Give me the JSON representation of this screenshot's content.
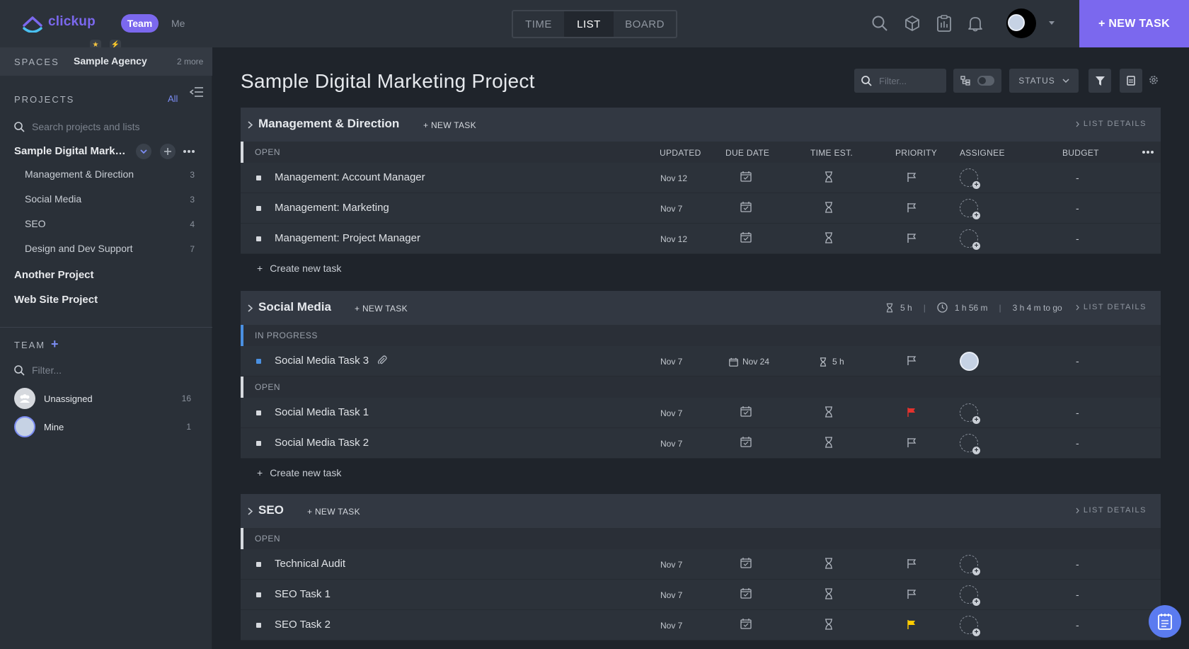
{
  "brand": {
    "name": "clickup",
    "color": "#7b68ee"
  },
  "topbar": {
    "tab_team": "Team",
    "tab_me": "Me",
    "views": [
      "TIME",
      "LIST",
      "BOARD"
    ],
    "active_view": "LIST",
    "new_task_label": "+ NEW TASK",
    "icons": [
      "search-icon",
      "cube-icon",
      "clipboard-icon",
      "bell-icon"
    ]
  },
  "sidebar": {
    "spaces_label": "SPACES",
    "space_name": "Sample Agency",
    "space_more": "2 more",
    "projects_label": "PROJECTS",
    "projects_all": "All",
    "search_placeholder": "Search projects and lists",
    "current_project": "Sample Digital Marke...",
    "lists": [
      {
        "label": "Management & Direction",
        "count": "3"
      },
      {
        "label": "Social Media",
        "count": "3"
      },
      {
        "label": "SEO",
        "count": "4"
      },
      {
        "label": "Design and Dev Support",
        "count": "7"
      }
    ],
    "other_projects": [
      "Another Project",
      "Web Site Project"
    ],
    "team_label": "TEAM",
    "team_plus": "+",
    "team_filter_placeholder": "Filter...",
    "members": [
      {
        "name": "Unassigned",
        "count": "16"
      },
      {
        "name": "Mine",
        "count": "1"
      }
    ]
  },
  "main": {
    "title": "Sample Digital Marketing Project",
    "filter_placeholder": "Filter...",
    "status_label": "STATUS",
    "columns": {
      "updated": "UPDATED",
      "due": "DUE DATE",
      "estimate": "TIME EST.",
      "priority": "PRIORITY",
      "assignee": "ASSIGNEE",
      "budget": "BUDGET"
    },
    "list_details": "LIST DETAILS",
    "new_task": "+ NEW TASK",
    "create_task": "Create new task",
    "sections": [
      {
        "title": "Management & Direction",
        "groups": [
          {
            "status": "OPEN",
            "tasks": [
              {
                "name": "Management: Account Manager",
                "updated": "Nov 12",
                "budget": "-"
              },
              {
                "name": "Management: Marketing",
                "updated": "Nov 7",
                "budget": "-"
              },
              {
                "name": "Management: Project Manager",
                "updated": "Nov 12",
                "budget": "-"
              }
            ]
          }
        ]
      },
      {
        "title": "Social Media",
        "stats": {
          "estimate": "5 h",
          "tracked": "1 h 56 m",
          "remaining": "3 h 4 m to go"
        },
        "groups": [
          {
            "status": "IN PROGRESS",
            "tasks": [
              {
                "name": "Social Media Task 3",
                "updated": "Nov 7",
                "due": "Nov 24",
                "estimate": "5 h",
                "budget": "-"
              }
            ]
          },
          {
            "status": "OPEN",
            "tasks": [
              {
                "name": "Social Media Task 1",
                "updated": "Nov 7",
                "budget": "-",
                "priority": "urgent"
              },
              {
                "name": "Social Media Task 2",
                "updated": "Nov 7",
                "budget": "-"
              }
            ]
          }
        ]
      },
      {
        "title": "SEO",
        "groups": [
          {
            "status": "OPEN",
            "tasks": [
              {
                "name": "Technical Audit",
                "updated": "Nov 7",
                "budget": "-"
              },
              {
                "name": "SEO Task 1",
                "updated": "Nov 7",
                "budget": "-"
              },
              {
                "name": "SEO Task 2",
                "updated": "Nov 7",
                "budget": "-",
                "priority": "high"
              }
            ]
          }
        ]
      }
    ]
  },
  "colors": {
    "accent": "#7b68ee",
    "in_progress": "#4a90e2",
    "urgent_flag": "#e5322d",
    "high_flag": "#ffcc00"
  }
}
